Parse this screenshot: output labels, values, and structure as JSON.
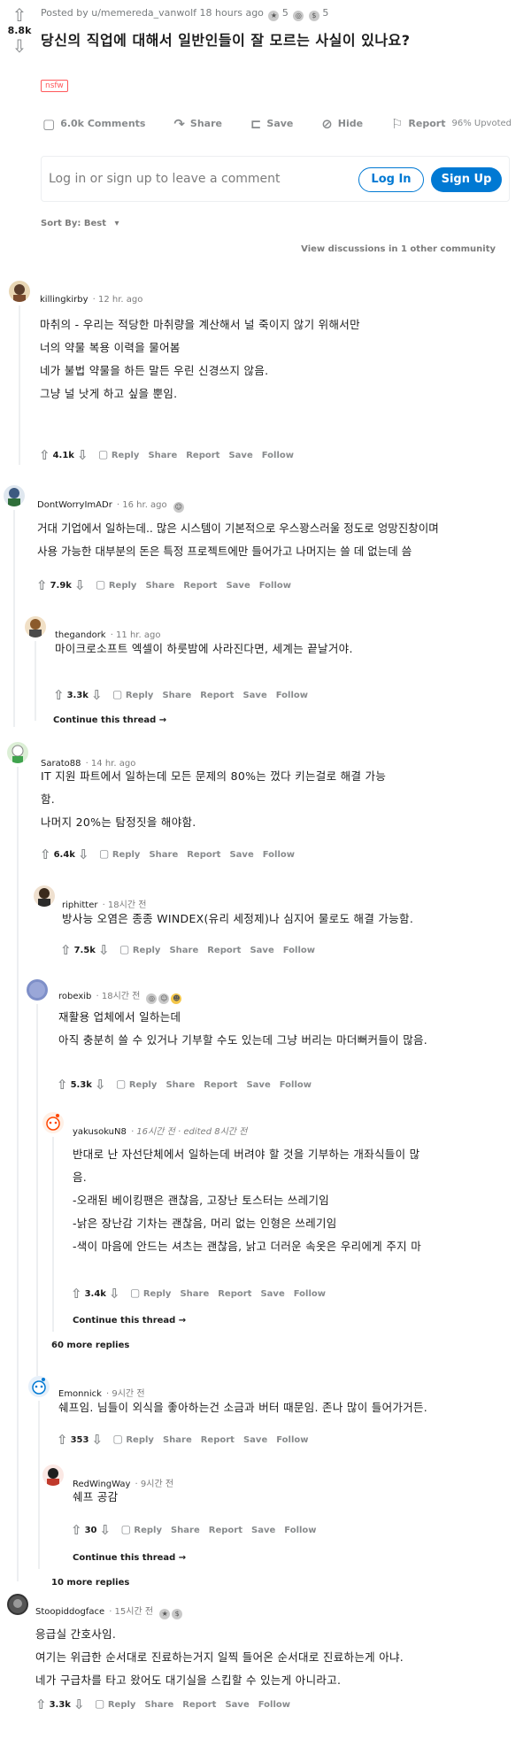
{
  "colors": {
    "brand_blue": "#0079d3",
    "nsfw_red": "#ff585b",
    "muted": "#878a8c"
  },
  "post": {
    "score": "8.8k",
    "meta": "Posted by u/memereda_vanwolf 18 hours ago",
    "awards": [
      "5",
      "5"
    ],
    "title": "당신의 직업에 대해서 일반인들이 잘 모르는 사실이 있나요?",
    "tag": "nsfw",
    "actions": {
      "comments": "6.0k Comments",
      "share": "Share",
      "save": "Save",
      "hide": "Hide",
      "report": "Report"
    },
    "upvoted": "96% Upvoted"
  },
  "login": {
    "prompt": "Log in or sign up to leave a comment",
    "login_label": "Log In",
    "signup_label": "Sign Up"
  },
  "sort": {
    "label": "Sort By: Best"
  },
  "view_discussions": "View discussions in 1 other community",
  "action_labels": {
    "reply": "Reply",
    "share": "Share",
    "report": "Report",
    "save": "Save",
    "follow": "Follow"
  },
  "comments": {
    "c1": {
      "user": "killingkirby",
      "time": "· 12 hr. ago",
      "lines": [
        "마취의 - 우리는 적당한 마취량을 계산해서 널 죽이지 않기 위해서만",
        "너의 약물 복용 이력을 물어봄",
        "네가 불법 약물을 하든 말든 우린 신경쓰지 않음.",
        "그냥 널 낫게 하고 싶을 뿐임."
      ],
      "score": "4.1k"
    },
    "c2": {
      "user": "DontWorryImADr",
      "time": "· 16 hr. ago",
      "lines": [
        "거대 기업에서 일하는데.. 많은 시스템이 기본적으로 우스꽝스러울 정도로 엉망진창이며",
        "사용 가능한 대부분의 돈은 특정 프로젝트에만 들어가고 나머지는 쓸 데 없는데 씀"
      ],
      "score": "7.9k"
    },
    "c2r1": {
      "user": "thegandork",
      "time": "· 11 hr. ago",
      "lines": [
        "마이크로소프트 엑셀이 하룻밤에 사라진다면, 세계는 끝날거야."
      ],
      "score": "3.3k"
    },
    "c2_continue": "Continue this thread →",
    "c3": {
      "user": "Sarato88",
      "time": "· 14 hr. ago",
      "lines": [
        "IT 지원 파트에서 일하는데 모든 문제의 80%는 껐다 키는걸로 해결 가능",
        "함.",
        "나머지 20%는 탐정짓을 해야함."
      ],
      "score": "6.4k"
    },
    "c3r1": {
      "user": "riphitter",
      "time": "· 18시간 전",
      "lines": [
        "방사능 오염은 종종 WINDEX(유리 세정제)나 심지어 물로도 해결 가능함."
      ],
      "score": "7.5k"
    },
    "c3r2": {
      "user": "robexib",
      "time": "· 18시간 전",
      "lines": [
        "재활용 업체에서 일하는데",
        "아직 충분히 쓸 수 있거나 기부할 수도 있는데 그냥 버리는 마더뻐커들이 많음."
      ],
      "score": "5.3k"
    },
    "c3r3": {
      "user": "yakusokuN8",
      "time": "· 16시간 전 · edited 8시간 전",
      "lines": [
        "반대로 난 자선단체에서 일하는데 버려야 할 것을 기부하는 개좌식들이 많",
        "음.",
        "-오래된 베이킹팬은 괜찮음, 고장난 토스터는 쓰레기임",
        "-낡은 장난감 기차는 괜찮음, 머리 없는 인형은 쓰레기임",
        "-색이 마음에 안드는 셔츠는 괜찮음, 낡고 더러운 속옷은 우리에게 주지 마"
      ],
      "score": "3.4k"
    },
    "c3r3_continue": "Continue this thread →",
    "c3_more": "60 more replies",
    "c3r4": {
      "user": "Emonnick",
      "time": "· 9시간 전",
      "lines": [
        "쉐프임. 님들이 외식을 좋아하는건 소금과 버터 때문임. 존나 많이 들어가거든."
      ],
      "score": "353"
    },
    "c3r5": {
      "user": "RedWingWay",
      "time": "· 9시간 전",
      "lines": [
        "쉐프 공감"
      ],
      "score": "30"
    },
    "c3r5_continue": "Continue this thread →",
    "c3_more2": "10 more replies",
    "c4": {
      "user": "Stoopiddogface",
      "time": "· 15시간 전",
      "lines": [
        "응급실 간호사임.",
        "여기는 위급한 순서대로 진료하는거지 일찍 들어온 순서대로 진료하는게 아냐.",
        "네가 구급차를 타고 왔어도 대기실을 스킵할 수 있는게 아니라고."
      ],
      "score": "3.3k"
    }
  }
}
